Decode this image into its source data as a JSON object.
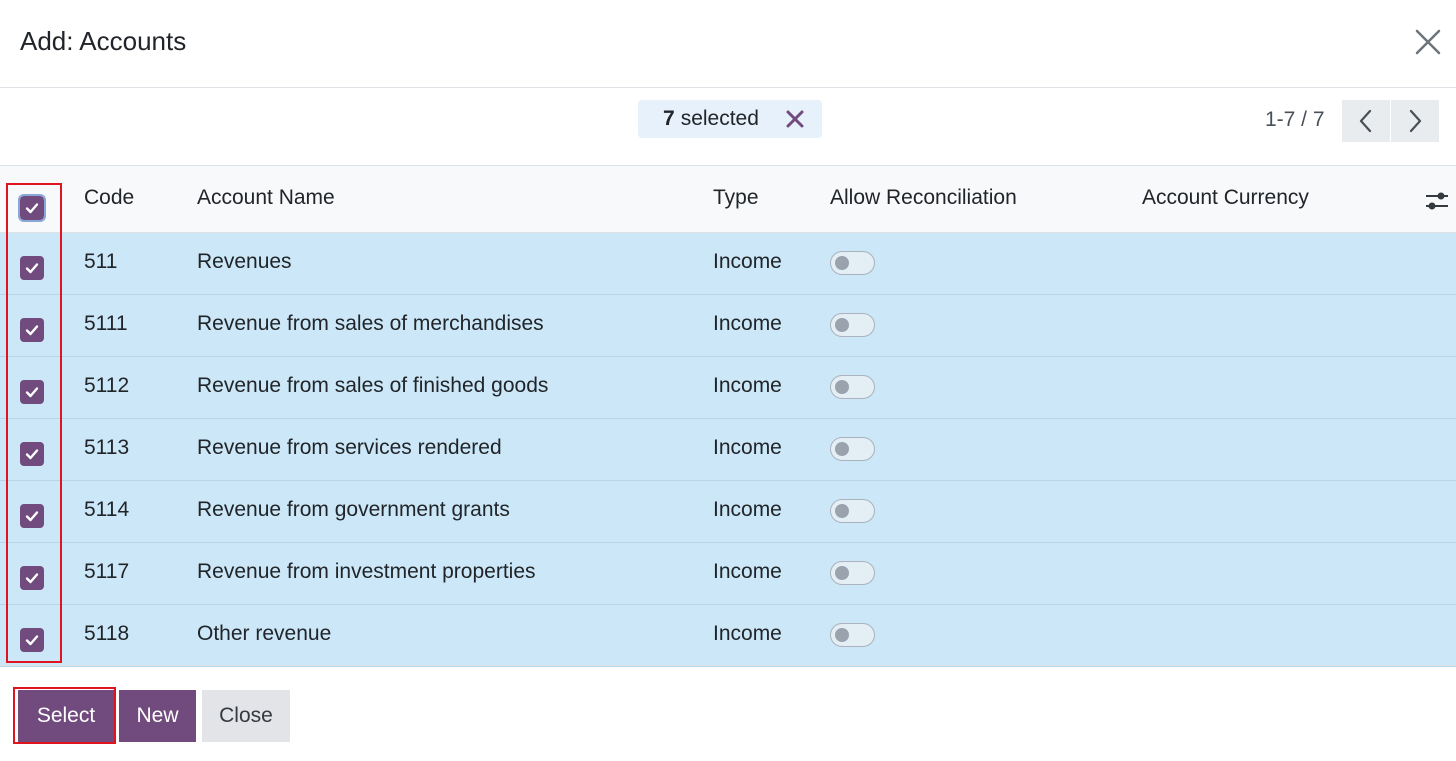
{
  "dialog": {
    "title": "Add: Accounts"
  },
  "selection": {
    "count": "7",
    "label": "selected"
  },
  "pager": {
    "text": "1-7 / 7"
  },
  "table": {
    "columns": [
      "Code",
      "Account Name",
      "Type",
      "Allow Reconciliation",
      "Account Currency"
    ],
    "rows": [
      {
        "code": "511",
        "name": "Revenues",
        "type": "Income",
        "checked": true,
        "reconcile": false,
        "currency": ""
      },
      {
        "code": "5111",
        "name": "Revenue from sales of merchandises",
        "type": "Income",
        "checked": true,
        "reconcile": false,
        "currency": ""
      },
      {
        "code": "5112",
        "name": "Revenue from sales of finished goods",
        "type": "Income",
        "checked": true,
        "reconcile": false,
        "currency": ""
      },
      {
        "code": "5113",
        "name": "Revenue from services rendered",
        "type": "Income",
        "checked": true,
        "reconcile": false,
        "currency": ""
      },
      {
        "code": "5114",
        "name": "Revenue from government grants",
        "type": "Income",
        "checked": true,
        "reconcile": false,
        "currency": ""
      },
      {
        "code": "5117",
        "name": "Revenue from investment properties",
        "type": "Income",
        "checked": true,
        "reconcile": false,
        "currency": ""
      },
      {
        "code": "5118",
        "name": "Other revenue",
        "type": "Income",
        "checked": true,
        "reconcile": false,
        "currency": ""
      }
    ]
  },
  "footer": {
    "select_label": "Select",
    "new_label": "New",
    "close_label": "Close"
  },
  "colors": {
    "primary": "#714b7e",
    "row_selected": "#cce8f8",
    "highlight": "#e0141e"
  }
}
